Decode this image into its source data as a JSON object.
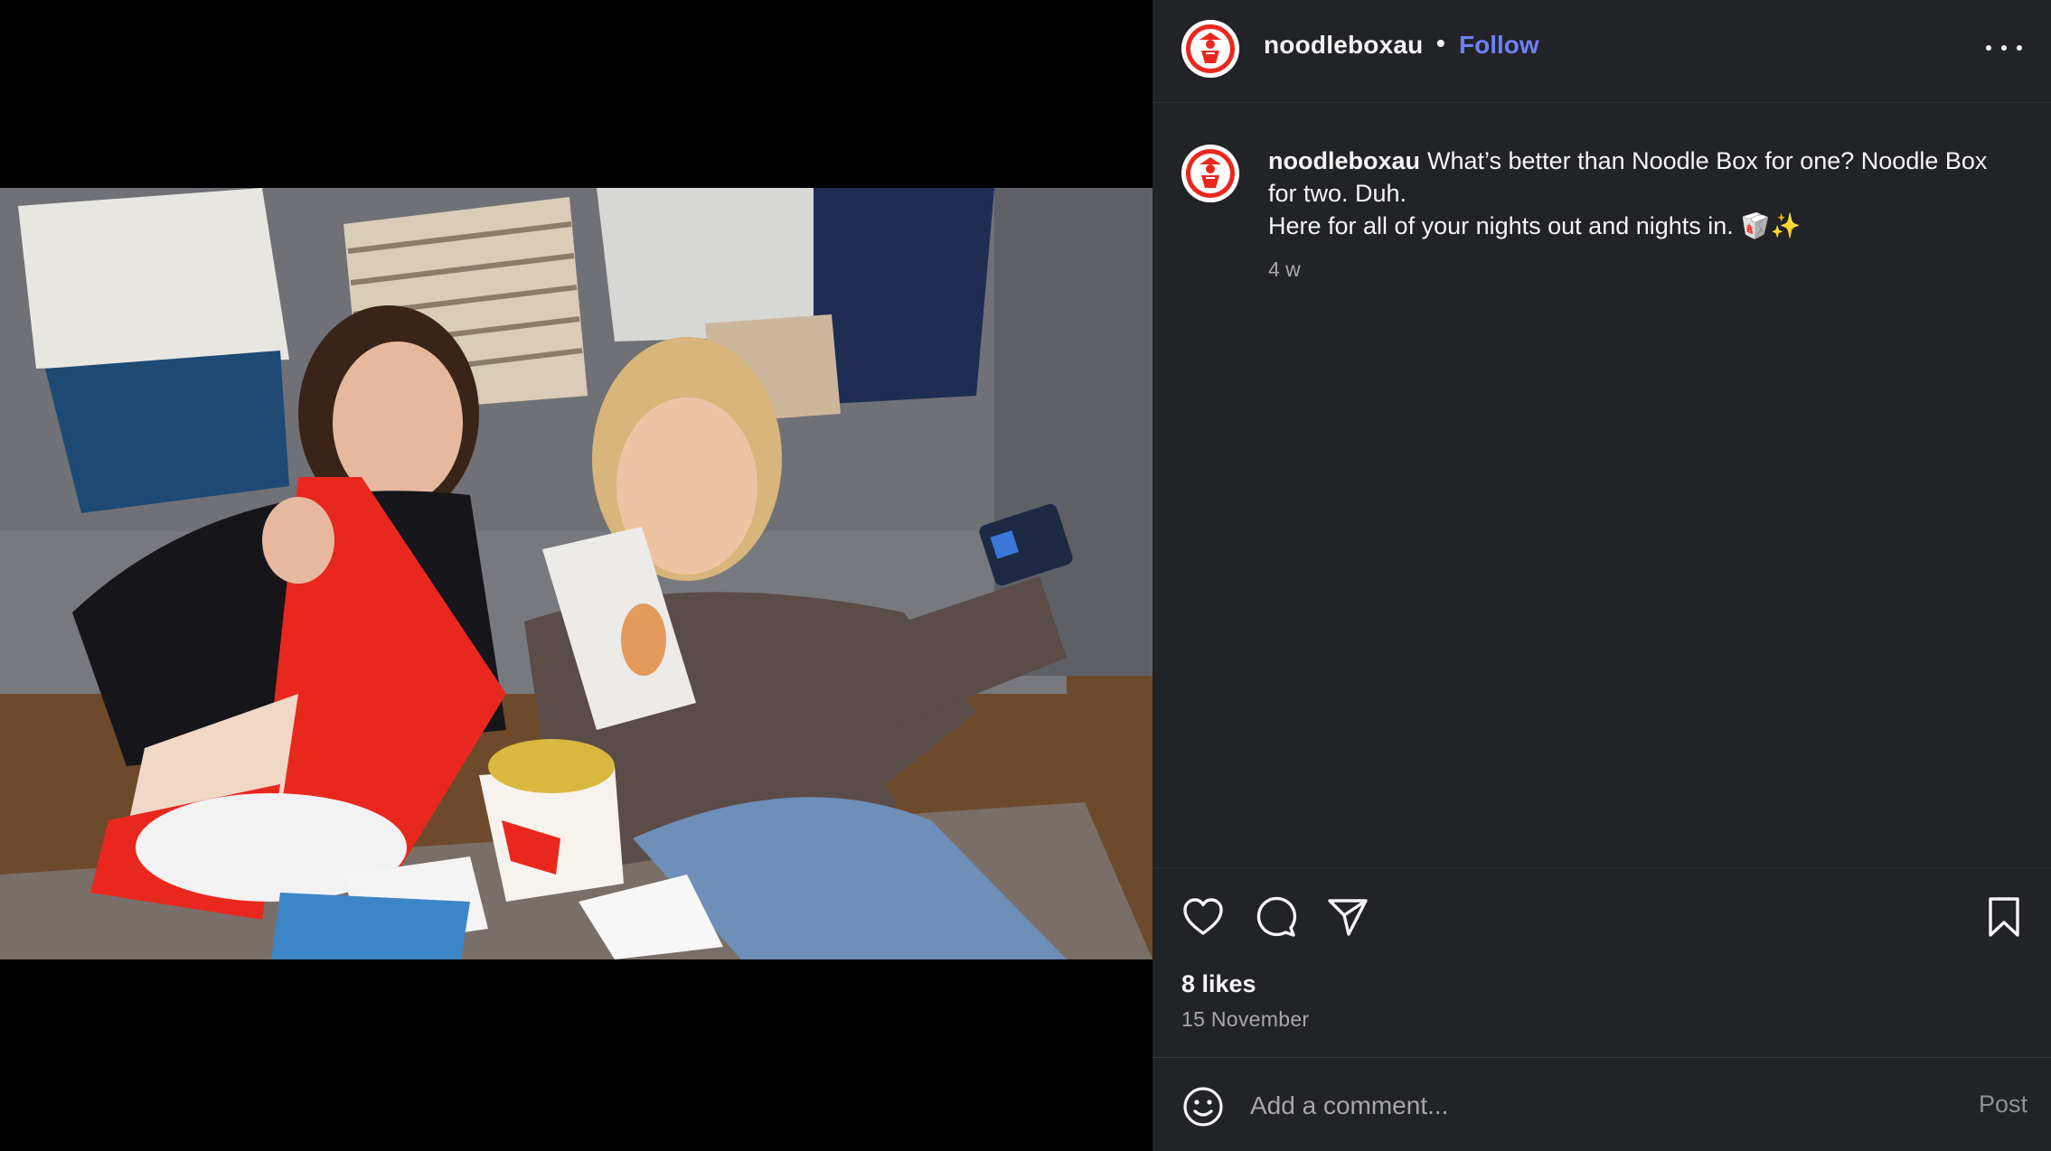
{
  "post": {
    "username": "noodleboxau",
    "separator": "•",
    "follow_label": "Follow",
    "more_icon": "more-horizontal-icon"
  },
  "caption": {
    "username": "noodleboxau",
    "line1": "What’s better than Noodle Box for one? Noodle Box for two. Duh.",
    "line2": "Here for all of your nights out and nights in. 🥡✨",
    "time_ago": "4 w"
  },
  "actions": {
    "like_icon": "heart-icon",
    "comment_icon": "comment-icon",
    "share_icon": "paper-plane-icon",
    "save_icon": "bookmark-icon"
  },
  "stats": {
    "likes": "8 likes",
    "date": "15 November"
  },
  "comment_bar": {
    "emoji_icon": "smiley-icon",
    "placeholder": "Add a comment...",
    "post_label": "Post"
  },
  "colors": {
    "panel_bg": "#212327",
    "media_bg": "#000000",
    "follow_link": "#6f7ff7",
    "brand_red": "#e8281e",
    "secondary_text": "#a8a8a8"
  }
}
